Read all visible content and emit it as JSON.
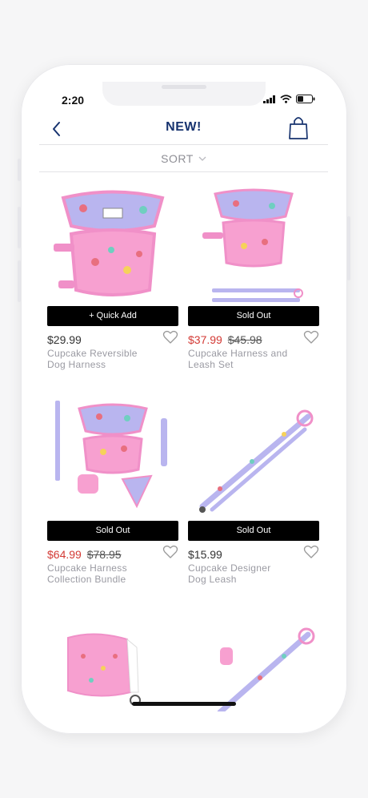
{
  "status": {
    "time": "2:20"
  },
  "header": {
    "title": "NEW!"
  },
  "sort": {
    "label": "SORT"
  },
  "products": [
    {
      "button": "+ Quick Add",
      "price": "$29.99",
      "original_price": "",
      "name_line1": "Cupcake Reversible",
      "name_line2": "Dog Harness"
    },
    {
      "button": "Sold Out",
      "price": "$37.99",
      "original_price": "$45.98",
      "name_line1": "Cupcake Harness and",
      "name_line2": "Leash Set"
    },
    {
      "button": "Sold Out",
      "price": "$64.99",
      "original_price": "$78.95",
      "name_line1": "Cupcake Harness",
      "name_line2": "Collection Bundle"
    },
    {
      "button": "Sold Out",
      "price": "$15.99",
      "original_price": "",
      "name_line1": "Cupcake Designer",
      "name_line2": "Dog Leash"
    }
  ],
  "colors": {
    "accent": "#17336f",
    "sale": "#d33a35",
    "button": "#000000",
    "pattern_bg": "#b9b5ef",
    "pattern_trim": "#f090c8"
  }
}
